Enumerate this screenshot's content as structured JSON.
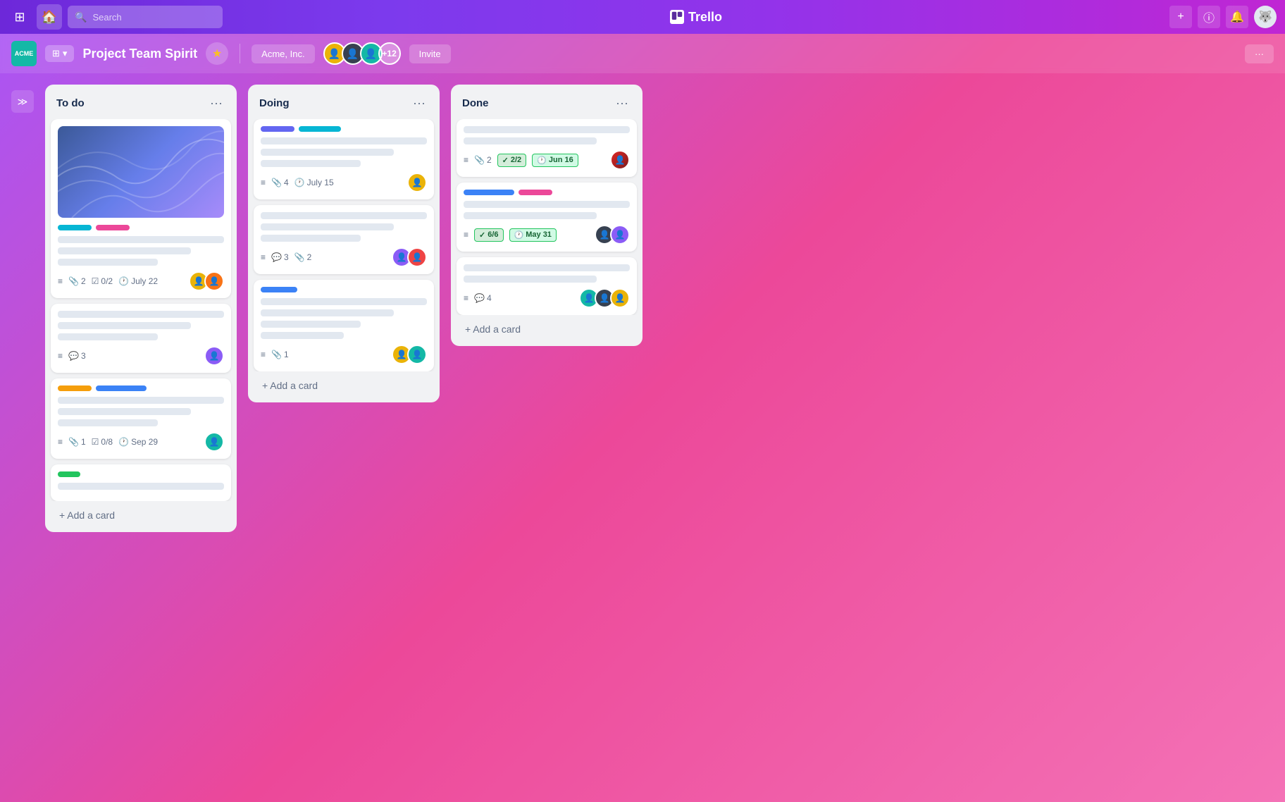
{
  "app": {
    "title": "Trello",
    "logo_text": "□□"
  },
  "nav": {
    "search_placeholder": "Search",
    "home_icon": "🏠",
    "grid_icon": "⊞",
    "add_icon": "+",
    "info_icon": "ⓘ",
    "bell_icon": "🔔"
  },
  "board": {
    "logo_text": "ACME",
    "title": "Project Team Spirit",
    "workspace": "Acme, Inc.",
    "members_extra": "+12",
    "invite_label": "Invite",
    "more_label": "···"
  },
  "columns": [
    {
      "id": "todo",
      "title": "To do",
      "add_card_label": "+ Add a card",
      "cards": [
        {
          "id": "todo-1",
          "has_image": true,
          "tags": [
            "cyan",
            "pink"
          ],
          "lines": [
            "full",
            "medium",
            "short"
          ],
          "meta_desc": true,
          "attachments": "2",
          "checklist": "0/2",
          "date": "July 22",
          "avatars": [
            "orange",
            "dark"
          ]
        },
        {
          "id": "todo-2",
          "has_image": false,
          "tags": [],
          "lines": [
            "full",
            "medium",
            "short"
          ],
          "meta_desc": true,
          "comments": "3",
          "avatars": [
            "purple"
          ]
        },
        {
          "id": "todo-3",
          "has_image": false,
          "tags": [
            "yellow",
            "blue"
          ],
          "lines": [
            "full",
            "medium",
            "short"
          ],
          "meta_desc": true,
          "attachments": "1",
          "checklist": "0/8",
          "date": "Sep 29",
          "avatars": [
            "teal"
          ]
        },
        {
          "id": "todo-4",
          "has_image": false,
          "tags": [
            "green"
          ],
          "lines": [
            "full"
          ],
          "meta_desc": false,
          "avatars": []
        }
      ]
    },
    {
      "id": "doing",
      "title": "Doing",
      "add_card_label": "+ Add a card",
      "cards": [
        {
          "id": "doing-1",
          "has_image": false,
          "progress_bars": [
            "indigo",
            "cyan"
          ],
          "lines": [
            "full",
            "medium",
            "short"
          ],
          "meta_desc": true,
          "attachments": "4",
          "date": "July 15",
          "avatars": [
            "yellow"
          ]
        },
        {
          "id": "doing-2",
          "has_image": false,
          "tags": [],
          "lines": [
            "full",
            "medium",
            "short"
          ],
          "meta_desc": true,
          "comments": "3",
          "attachments": "2",
          "avatars": [
            "purple",
            "red"
          ]
        },
        {
          "id": "doing-3",
          "has_image": false,
          "progress_bars": [
            "blue"
          ],
          "lines": [
            "full",
            "medium",
            "short",
            "short"
          ],
          "meta_desc": true,
          "attachments": "1",
          "avatars": [
            "yellow",
            "teal"
          ]
        }
      ]
    },
    {
      "id": "done",
      "title": "Done",
      "add_card_label": "+ Add a card",
      "cards": [
        {
          "id": "done-1",
          "has_image": false,
          "tags": [],
          "lines": [
            "full",
            "medium"
          ],
          "meta_desc": true,
          "attachments": "2",
          "badge": "2/2",
          "date": "Jun 16",
          "avatars": [
            "red-beard"
          ]
        },
        {
          "id": "done-2",
          "has_image": false,
          "tags": [
            "blue",
            "pink"
          ],
          "lines": [
            "full",
            "medium"
          ],
          "meta_desc": true,
          "badge": "6/6",
          "date": "May 31",
          "avatars": [
            "dark",
            "purple"
          ]
        },
        {
          "id": "done-3",
          "has_image": false,
          "tags": [],
          "lines": [
            "full",
            "medium"
          ],
          "meta_desc": true,
          "comments": "4",
          "avatars": [
            "teal",
            "dark",
            "yellow"
          ]
        }
      ]
    }
  ]
}
